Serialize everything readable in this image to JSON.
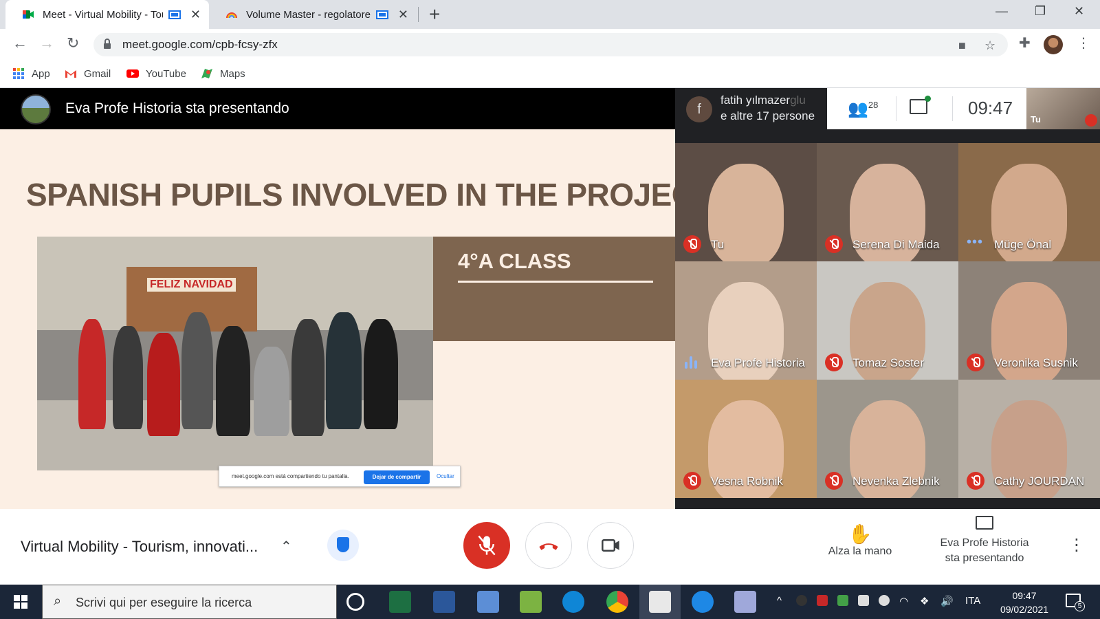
{
  "browser": {
    "tabs": [
      {
        "title": "Meet - Virtual Mobility - Tou"
      },
      {
        "title": "Volume Master - regolatore"
      }
    ],
    "url": "meet.google.com/cpb-fcsy-zfx",
    "bookmarks": [
      {
        "label": "App",
        "icon": "apps-grid-icon"
      },
      {
        "label": "Gmail",
        "icon": "gmail-icon"
      },
      {
        "label": "YouTube",
        "icon": "youtube-icon"
      },
      {
        "label": "Maps",
        "icon": "maps-icon"
      }
    ]
  },
  "meet": {
    "presenting_banner": "Eva Profe Historia sta presentando",
    "speaker": {
      "initial": "f",
      "line1": "fatih yılmazer",
      "line1_faded": "glu",
      "line2": "e altre 17 persone"
    },
    "participants_count": "28",
    "clock": "09:47",
    "self_tile_label": "Tu",
    "slide": {
      "title": "SPANISH PUPILS INVOLVED IN THE PROJECT",
      "banner": "4°A CLASS",
      "board_text": "FELIZ NAVIDAD",
      "share_msg": "meet.google.com está compartiendo tu pantalla.",
      "share_stop": "Dejar de compartir",
      "share_hide": "Ocultar"
    },
    "tiles": [
      {
        "name": "Tu",
        "status": "muted",
        "bg": "#5c4d45",
        "skin": "#d8b49a"
      },
      {
        "name": "Serena Di Maida",
        "status": "muted",
        "bg": "#6a5a4f",
        "skin": "#d7b39c"
      },
      {
        "name": "Müge Önal",
        "status": "dots",
        "bg": "#8a6a4a",
        "skin": "#d2a98c"
      },
      {
        "name": "Eva Profe Historia",
        "status": "speaking",
        "bg": "#b39d8a",
        "skin": "#e8d0bd"
      },
      {
        "name": "Tomaz Soster",
        "status": "muted",
        "bg": "#c9c7c2",
        "skin": "#c9a58b"
      },
      {
        "name": "Veronika Susnik",
        "status": "muted",
        "bg": "#8d8278",
        "skin": "#d3a68b"
      },
      {
        "name": "Vesna Robnik",
        "status": "muted",
        "bg": "#c49a6a",
        "skin": "#e3bca0"
      },
      {
        "name": "Nevenka Zlebnik",
        "status": "muted",
        "bg": "#9c968c",
        "skin": "#d8b39a"
      },
      {
        "name": "Cathy JOURDAN",
        "status": "muted",
        "bg": "#b8b0a6",
        "skin": "#c7a08a"
      }
    ],
    "controls": {
      "meeting_name": "Virtual Mobility - Tourism, innovati...",
      "raise_hand": "Alza la mano",
      "present_line1": "Eva Profe Historia",
      "present_line2": "sta presentando"
    }
  },
  "taskbar": {
    "search_placeholder": "Scrivi qui per eseguire la ricerca",
    "lang": "ITA",
    "time": "09:47",
    "date": "09/02/2021",
    "notifications": "5"
  },
  "colors": {
    "accent": "#1a73e8",
    "danger": "#d93025",
    "slide_brown": "#7e654f"
  }
}
